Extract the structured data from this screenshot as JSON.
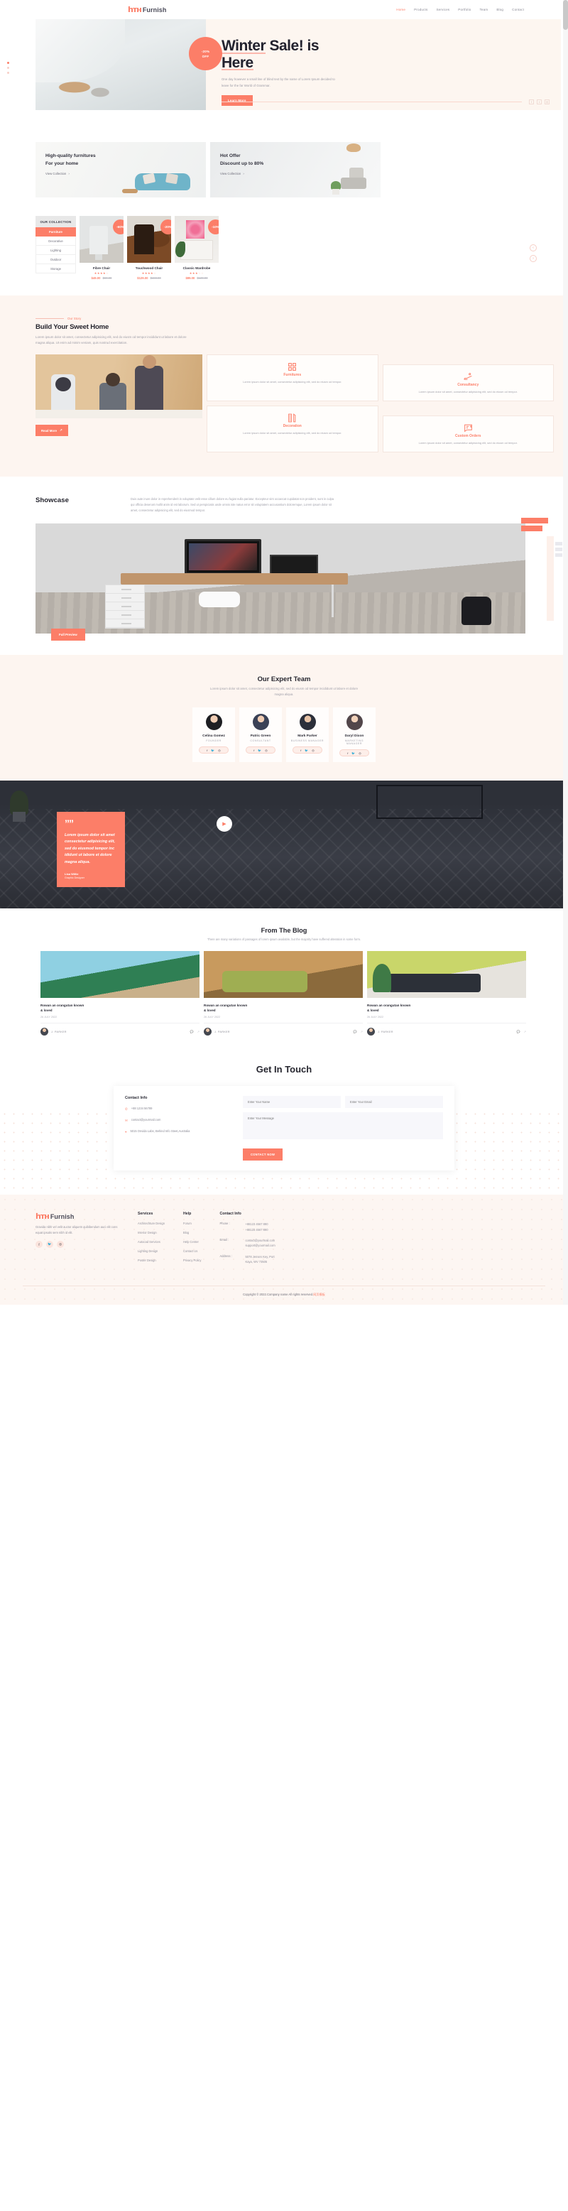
{
  "brand": {
    "mark": "һтн",
    "name": "Furnish"
  },
  "nav": {
    "items": [
      {
        "label": "Home",
        "active": true
      },
      {
        "label": "Products",
        "active": false
      },
      {
        "label": "Services",
        "active": false
      },
      {
        "label": "Portfolio",
        "active": false
      },
      {
        "label": "Team",
        "active": false
      },
      {
        "label": "Blog",
        "active": false
      },
      {
        "label": "Contact",
        "active": false
      }
    ]
  },
  "hero": {
    "badge_line1": "-20%",
    "badge_line2": "OFF",
    "title_part1": "Winter",
    "title_part2": " Sale! is",
    "title_part3": "Here",
    "subtitle": "One day however a small line of blind text by the name of Lorem Ipsum decided to leave for the far World of Grammar.",
    "button": "Learn More",
    "socials": [
      "f",
      "t",
      "ig"
    ]
  },
  "promos": [
    {
      "title_line1": "High-quality furnitures",
      "title_line2": "For your home",
      "link": "View Collection"
    },
    {
      "title_line1": "Hot Offer",
      "title_line2": "Discount up to 80%",
      "link": "View Collection"
    }
  ],
  "collection": {
    "heading": "OUR COLLECTION",
    "categories": [
      {
        "label": "Furniture",
        "active": true
      },
      {
        "label": "Decorative",
        "active": false
      },
      {
        "label": "Lighting",
        "active": false
      },
      {
        "label": "Outdoor",
        "active": false
      },
      {
        "label": "Storage",
        "active": false
      }
    ],
    "products": [
      {
        "name": "Fibre Chair",
        "discount": "-60%",
        "stars": 4,
        "price_now": "$49.00",
        "price_was": "$69.00"
      },
      {
        "name": "Touchwood Chair",
        "discount": "-20%",
        "stars": 4,
        "price_now": "$129.00",
        "price_was": "$159.00"
      },
      {
        "name": "Classic Wardrobe",
        "discount": "-10%",
        "stars": 3,
        "price_now": "$89.00",
        "price_was": "$129.00"
      }
    ],
    "prev_icon": "‹",
    "next_icon": "›"
  },
  "story": {
    "eyebrow": "Our Story",
    "heading": "Build Your Sweet Home",
    "lead": "Lorem ipsum dolor sit amet, consectetur adipisicing elit, sed do eiusm od tempor incididunt ut labore et dolore magna aliqua. Ut enim ad minim veniam, quis nostrud exercitation.",
    "button": "Read More",
    "cards": [
      {
        "icon": "grid",
        "title": "Furnitures",
        "text": "Lorem ipsum dolor sit amet, consectetur adipisicing elit, sed do eiusm od tempor."
      },
      {
        "icon": "handshake",
        "title": "Consultancy",
        "text": "Lorem ipsum dolor sit amet, consectetur adipisicing elit, sed do eiusm od tempor."
      },
      {
        "icon": "ruler-pencil",
        "title": "Decoration",
        "text": "Lorem ipsum dolor sit amet, consectetur adipisicing elit, sed do eiusm od tempor."
      },
      {
        "icon": "chat-question",
        "title": "Custom Orders",
        "text": "Lorem ipsum dolor sit amet, consectetur adipisicing elit, sed do eiusm od tempor."
      }
    ]
  },
  "showcase": {
    "heading": "Showcase",
    "text": "Duis aute inure dolor in reprehenderit in voluptate velit esse cillum dolore eu fugiat nulla pariatur. Excepteur sint occaecat cupidatat non proident, sunt in culpa qui officia deserunt mollit anim id est laborum. Sed ut perspiciatis unde omnis iste natus error sit voluptatem accusantium doloremque, Lorem ipsum dolor sit amet, consectetur adipisicing elit, sed do eiusmod tempor.",
    "button": "Full Preview"
  },
  "team": {
    "heading": "Our Expert Team",
    "subtitle": "Lorem ipsum dolor sit amet, consectetur adipisicing elit, sed do eiusm od tempor incididunt ut labore et dolore magna aliqua.",
    "members": [
      {
        "name": "Celina Gomez",
        "role": "FOUNDER"
      },
      {
        "name": "Patric Green",
        "role": "CONSULTANT"
      },
      {
        "name": "Mark Parker",
        "role": "BUSINESS MANAGER"
      },
      {
        "name": "Daryl Dixon",
        "role": "MARKETING MANAGER"
      }
    ]
  },
  "testimonial": {
    "quote_mark": "””",
    "quote": "Lorem ipsum dolor sit amet consectetur adipisicing elit, sed do eiusmod tempor inc ididunt ut labore et dolore magna aliqua.",
    "author": "Lisa Willie",
    "author_role": "Graphic Designer",
    "play_icon": "▶"
  },
  "blog": {
    "heading": "From The Blog",
    "subtitle": "There are many variations of passages of lorem ipsum available, but the majority have suffered alteration in some form.",
    "posts": [
      {
        "title_line1": "Rowan an orangutan known",
        "title_line2": "& loved",
        "date": "26 JULY 2022",
        "author": "J. PARKER"
      },
      {
        "title_line1": "Rowan an orangutan known",
        "title_line2": "& loved",
        "date": "26 JULY 2022",
        "author": "J. PARKER"
      },
      {
        "title_line1": "Rowan an orangutan known",
        "title_line2": "& loved",
        "date": "26 JULY 2022",
        "author": "J. PARKER"
      }
    ]
  },
  "contact": {
    "heading": "Get In Touch",
    "info_heading": "Contact Info",
    "phone": "+88 1234 56789",
    "email": "contact@yourmail.com",
    "address": "5015 Onvida Labs, Behind Info Steet,Australia",
    "name_placeholder": "Enter Your Name",
    "email_placeholder": "Enter Your Email",
    "message_placeholder": "Enter Your Message",
    "submit": "CONTACT NOW"
  },
  "footer": {
    "about": "Gravida nibh vel velit auctor aliquetn quibibendum auci elit cons equat ipsutis sem nibh id elit.",
    "socials": [
      "f",
      "t",
      "ig"
    ],
    "services": {
      "title": "Services",
      "items": [
        "Architechture Design",
        "Interior Design",
        "Autocad Services",
        "Lighting Design",
        "Poster Design"
      ]
    },
    "help": {
      "title": "Help",
      "items": [
        "Forum",
        "Blog",
        "Help Center",
        "Contact Us",
        "Privacy Policy"
      ]
    },
    "contact": {
      "title": "Contact Info",
      "phone_label": "Phone :",
      "phone1": "+88123 4567 890",
      "phone2": "+88123 4567 890",
      "email_label": "Email :",
      "email1": "contact@yourmail.com",
      "email2": "support@yourmail.com",
      "address_label": "Address :",
      "address1": "5078 Jensen Key, Port",
      "address2": "Kaya, WV 73505"
    },
    "copyright": "Copyright © 2022.Company name All rights reserved.",
    "copyright_suffix": "网页模板"
  },
  "colors": {
    "accent": "#fc7e68",
    "cream": "#fdf5f0",
    "dark": "#26262f"
  }
}
